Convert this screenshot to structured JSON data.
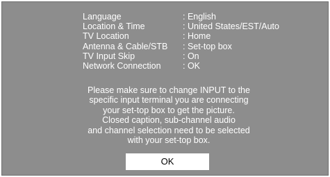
{
  "settings": [
    {
      "label": "Language",
      "value": ": English"
    },
    {
      "label": "Location & Time",
      "value": ": United States/EST/Auto"
    },
    {
      "label": "TV Location",
      "value": ": Home"
    },
    {
      "label": "Antenna & Cable/STB",
      "value": ": Set-top box"
    },
    {
      "label": "TV Input Skip",
      "value": ": On"
    },
    {
      "label": "Network Connection",
      "value": ": OK"
    }
  ],
  "message": {
    "lines": [
      "Please make sure to change INPUT to the",
      "specific input terminal you are connecting",
      "your set-top box to get the picture.",
      "Closed caption, sub-channel audio",
      "and channel selection need to be selected",
      "with your set-top box."
    ]
  },
  "ok_label": "OK",
  "colors": {
    "background": "#8d8d8d",
    "text": "#ffffff",
    "button_bg": "#ffffff",
    "button_text": "#000000"
  }
}
